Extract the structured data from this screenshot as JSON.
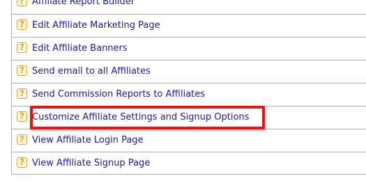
{
  "menu": {
    "items": [
      {
        "label": "Affiliate Report Builder"
      },
      {
        "label": "Edit Affiliate Marketing Page"
      },
      {
        "label": "Edit Affiliate Banners"
      },
      {
        "label": "Send email to all Affiliates"
      },
      {
        "label": "Send Commission Reports to Affiliates"
      },
      {
        "label": "Customize Affiliate Settings and Signup Options"
      },
      {
        "label": "View Affiliate Login Page"
      },
      {
        "label": "View Affiliate Signup Page"
      }
    ],
    "help_glyph": "?",
    "link_color": "#1a1aa6",
    "icon_color": "#e0a23a",
    "highlight_color": "#e8151b"
  }
}
